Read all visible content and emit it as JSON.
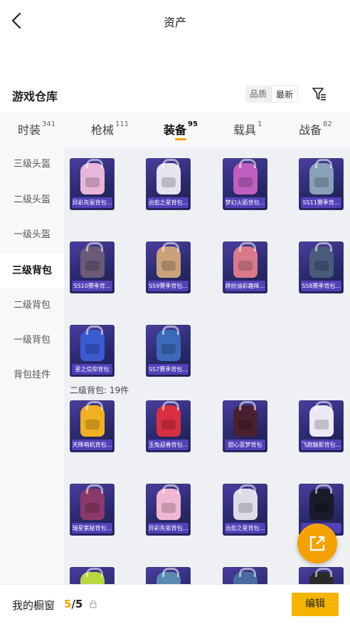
{
  "header": {
    "title": "资产"
  },
  "warehouse": {
    "title": "游戏仓库",
    "sort_options": [
      "品质",
      "最新"
    ],
    "sort_selected": "最新"
  },
  "tabs": [
    {
      "label": "时装",
      "count": "341"
    },
    {
      "label": "枪械",
      "count": "111"
    },
    {
      "label": "装备",
      "count": "95",
      "active": true
    },
    {
      "label": "载具",
      "count": "1"
    },
    {
      "label": "战备",
      "count": "82"
    }
  ],
  "sidebar": {
    "items": [
      "三级头盔",
      "二级头盔",
      "一级头盔",
      "三级背包",
      "二级背包",
      "一级背包",
      "背包挂件"
    ],
    "active": "三级背包"
  },
  "items_lv3": [
    {
      "name": "异彩先驱背包...",
      "color": "#e8b6d8"
    },
    {
      "name": "治愈之星背包...",
      "color": "#e7e3ef"
    },
    {
      "name": "梦幻火箭背包...",
      "color": "#c05fc0"
    },
    {
      "name": "SS11赛季背...",
      "color": "#8aa0b8"
    },
    {
      "name": "SS10赛季背...",
      "color": "#6a5a78"
    },
    {
      "name": "SS9赛季背包...",
      "color": "#c9a27a"
    },
    {
      "name": "缤纷油彩趣味...",
      "color": "#d87a8a"
    },
    {
      "name": "SS8赛季背包...",
      "color": "#4a5a7a"
    },
    {
      "name": "星之信仰背包",
      "color": "#3a5ad0"
    },
    {
      "name": "SS7赛季背包...",
      "color": "#3a6ab8"
    }
  ],
  "section_lv2": {
    "header": "二级背包: 19件"
  },
  "items_lv2": [
    {
      "name": "天降萌机背包...",
      "color": "#f0b020"
    },
    {
      "name": "玉兔迎春背包...",
      "color": "#d83040"
    },
    {
      "name": "甜心亚梦背包",
      "color": "#4a2030"
    },
    {
      "name": "飞跑魅影背包...",
      "color": "#ece8f4"
    },
    {
      "name": "瑞星紫秘背包...",
      "color": "#8a3a6a"
    },
    {
      "name": "异彩先驱背包...",
      "color": "#f0b8d0"
    },
    {
      "name": "治愈之星背包...",
      "color": "#dedce8"
    },
    {
      "name": "暗...",
      "color": "#1a1a2a"
    }
  ],
  "items_partial_colors": [
    "#b8d840",
    "#5a8ab0",
    "#4a6aa0",
    "#2a2a2a"
  ],
  "bottom": {
    "showcase_label": "我的橱窗",
    "showcase_current": "5",
    "showcase_total": "/5",
    "edit_label": "编辑"
  },
  "colors": {
    "accent": "#f5a200",
    "button": "#f5b400",
    "sidebar_bg": "#f7f8fa",
    "content_bg": "#eef0f3"
  }
}
